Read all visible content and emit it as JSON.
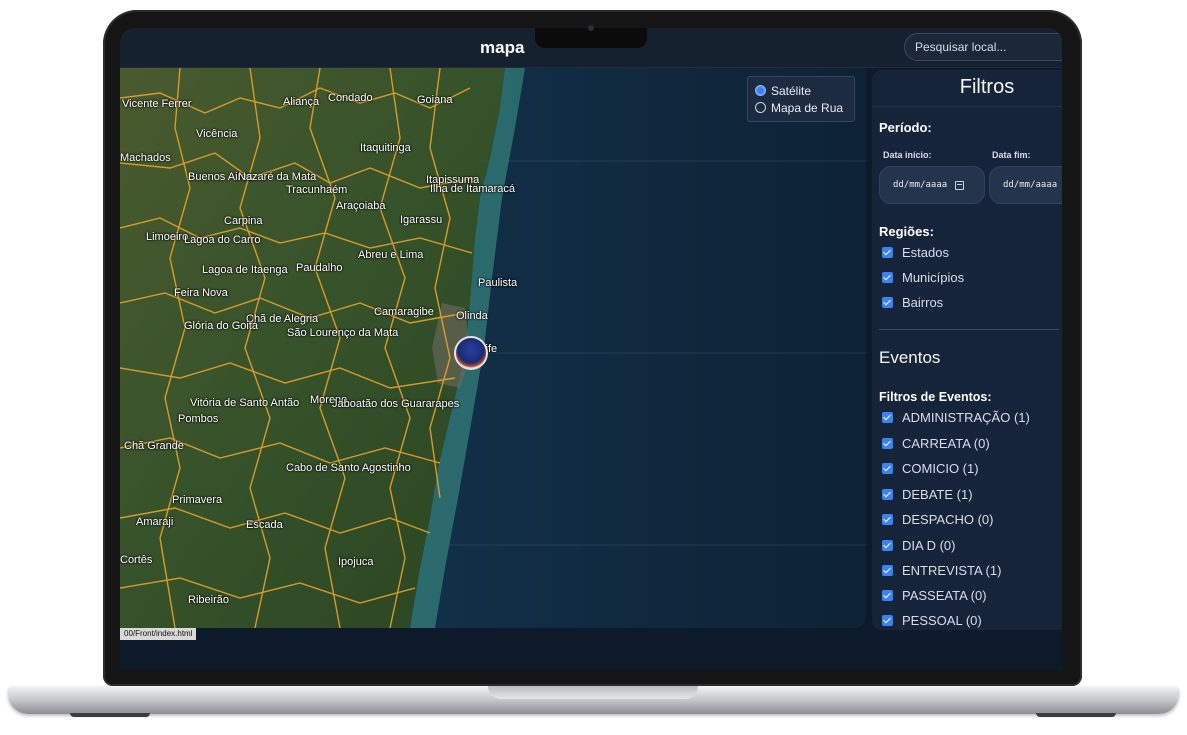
{
  "app": {
    "title": "mapa",
    "search_placeholder": "Pesquisar local..."
  },
  "map": {
    "layers": [
      {
        "label": "Satélite",
        "selected": true
      },
      {
        "label": "Mapa de Rua",
        "selected": false
      }
    ],
    "place_labels": [
      "Vicente Ferrer",
      "Aliança",
      "Condado",
      "Goiana",
      "Vicência",
      "Itaquitinga",
      "Machados",
      "Buenos Aires",
      "Nazaré da Mata",
      "Tracunhaém",
      "Itapissuma",
      "Ilha de Itamaracá",
      "Araçoiaba",
      "Carpina",
      "Igarassu",
      "Limoeiro",
      "Lagoa do Carro",
      "Abreu e Lima",
      "Lagoa de Itaenga",
      "Paudalho",
      "Paulista",
      "Feira Nova",
      "Chã de Alegria",
      "Camaragibe",
      "Olinda",
      "Glória do Goitá",
      "São Lourenço da Mata",
      "Recife",
      "Vitória de Santo Antão",
      "Moreno",
      "Jaboatão dos Guararapes",
      "Pombos",
      "Chã Grande",
      "Cabo de Santo Agostinho",
      "Primavera",
      "Amaraji",
      "Escada",
      "Ipojuca",
      "Ribeirão",
      "Cortês"
    ],
    "status_url": "00/Front/index.html",
    "colors": {
      "boundary": "#e8a32a",
      "land": "#2f4a22",
      "sea": "#0f2740",
      "accent": "#3b82f6"
    }
  },
  "filters": {
    "title": "Filtros",
    "period": {
      "label": "Período:",
      "start_label": "Data início:",
      "start_placeholder": "dd/mm/aaaa",
      "end_label": "Data fim:",
      "end_placeholder": "dd/mm/aaaa"
    },
    "regions": {
      "label": "Regiões:",
      "items": [
        {
          "label": "Estados",
          "checked": true
        },
        {
          "label": "Municípios",
          "checked": true
        },
        {
          "label": "Bairros",
          "checked": true
        }
      ]
    },
    "events": {
      "title": "Eventos",
      "label": "Filtros de Eventos:",
      "items": [
        {
          "label": "ADMINISTRAÇÃO (1)",
          "checked": true
        },
        {
          "label": "CARREATA (0)",
          "checked": true
        },
        {
          "label": "COMICIO (1)",
          "checked": true
        },
        {
          "label": "DEBATE (1)",
          "checked": true
        },
        {
          "label": "DESPACHO (0)",
          "checked": true
        },
        {
          "label": "DIA D (0)",
          "checked": true
        },
        {
          "label": "ENTREVISTA (1)",
          "checked": true
        },
        {
          "label": "PASSEATA (0)",
          "checked": true
        },
        {
          "label": "PESSOAL (0)",
          "checked": true
        }
      ]
    }
  }
}
